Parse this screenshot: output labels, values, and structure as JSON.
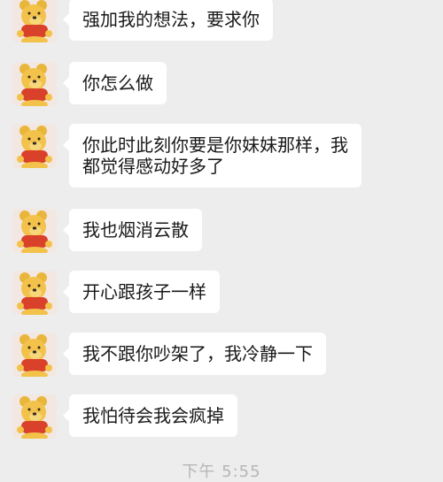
{
  "messages": [
    {
      "text": "强加我的想法，要求你",
      "avatar_icon": "pooh-bear-icon"
    },
    {
      "text": "你怎么做",
      "avatar_icon": "pooh-bear-icon"
    },
    {
      "text": "你此时此刻你要是你妹妹那样，我\n都觉得感动好多了",
      "avatar_icon": "pooh-bear-icon"
    },
    {
      "text": "我也烟消云散",
      "avatar_icon": "pooh-bear-icon"
    },
    {
      "text": "开心跟孩子一样",
      "avatar_icon": "pooh-bear-icon"
    },
    {
      "text": "我不跟你吵架了，我冷静一下",
      "avatar_icon": "pooh-bear-icon"
    },
    {
      "text": "我怕待会我会疯掉",
      "avatar_icon": "pooh-bear-icon"
    }
  ],
  "timestamp": "下午 5:55",
  "colors": {
    "background": "#ededed",
    "bubble": "#ffffff",
    "text": "#191919",
    "avatar_bg": "#f3e7e2",
    "bear_fur": "#f2c24a",
    "bear_shirt": "#d9412b"
  }
}
